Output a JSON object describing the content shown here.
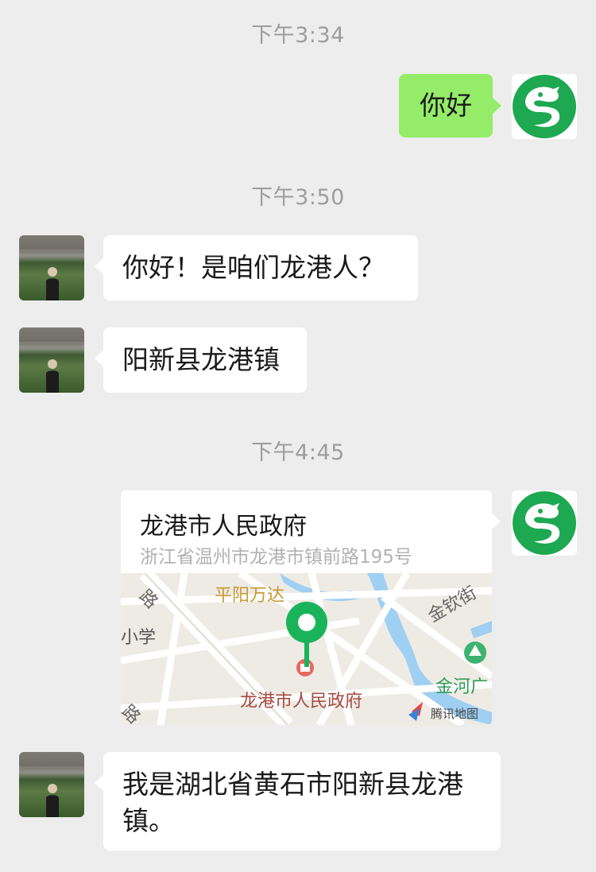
{
  "messages": {
    "time1": "下午3:34",
    "time2": "下午3:50",
    "time3": "下午4:45",
    "sent_hello": "你好",
    "recv_1": "你好！是咱们龙港人？",
    "recv_2": "阳新县龙港镇",
    "recv_3": "我是湖北省黄石市阳新县龙港镇。"
  },
  "location": {
    "title": "龙港市人民政府",
    "address": "浙江省温州市龙港市镇前路195号",
    "map_labels": {
      "road_tl": "路",
      "pingyang_wanda": "平阳万达",
      "jinqin_street": "金钦街",
      "school": "小学",
      "jinhe": "金河广",
      "gov": "龙港市人民政府",
      "road_bl": "路",
      "tencent_map": "腾讯地图"
    }
  },
  "colors": {
    "sent_bubble": "#95ec69",
    "received_bubble": "#ffffff",
    "background": "#ededed",
    "brand_green": "#1da851",
    "map_pin": "#19b45a"
  },
  "icons": {
    "my_avatar": "dragon-logo-icon",
    "contact_avatar": "person-photo-icon",
    "map_pin": "location-pin-icon",
    "poi": "government-poi-icon",
    "park": "tree-poi-icon",
    "tencent": "tencent-map-logo-icon"
  }
}
